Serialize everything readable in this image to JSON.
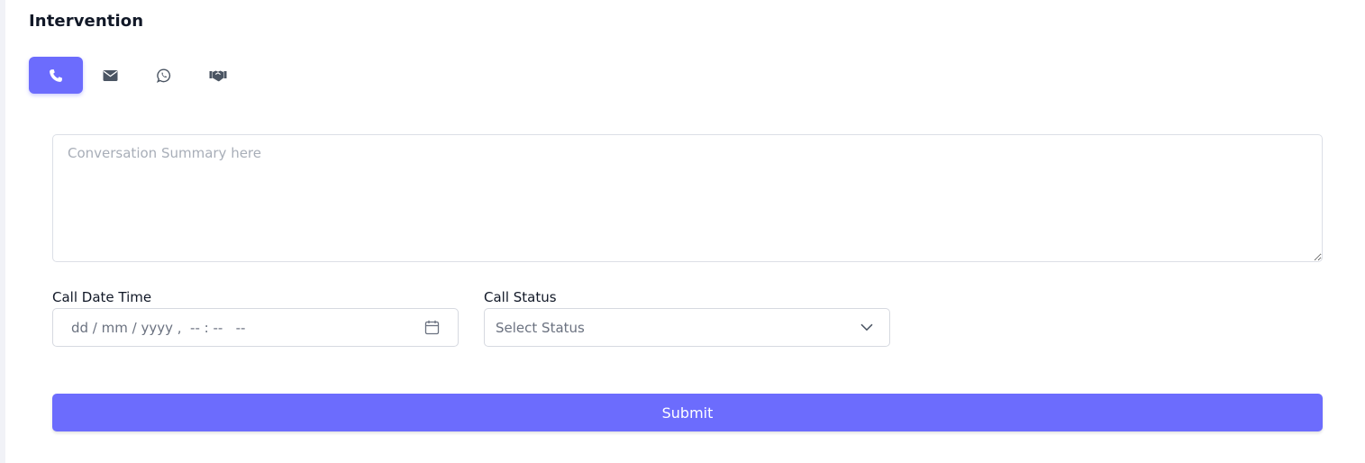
{
  "section": {
    "title": "Intervention"
  },
  "tabs": [
    {
      "icon": "phone-icon",
      "active": true
    },
    {
      "icon": "envelope-icon",
      "active": false
    },
    {
      "icon": "whatsapp-icon",
      "active": false
    },
    {
      "icon": "handshake-icon",
      "active": false
    }
  ],
  "summary": {
    "placeholder": "Conversation Summary here",
    "value": ""
  },
  "call_date_time": {
    "label": "Call Date Time",
    "placeholder": "dd / mm / yyyy ,  -- : --   --"
  },
  "call_status": {
    "label": "Call Status",
    "selected": "Select Status"
  },
  "submit": {
    "label": "Submit"
  },
  "colors": {
    "accent": "#6c6cfd",
    "icon_inactive": "#4b5563",
    "border": "#d6d9e0"
  }
}
